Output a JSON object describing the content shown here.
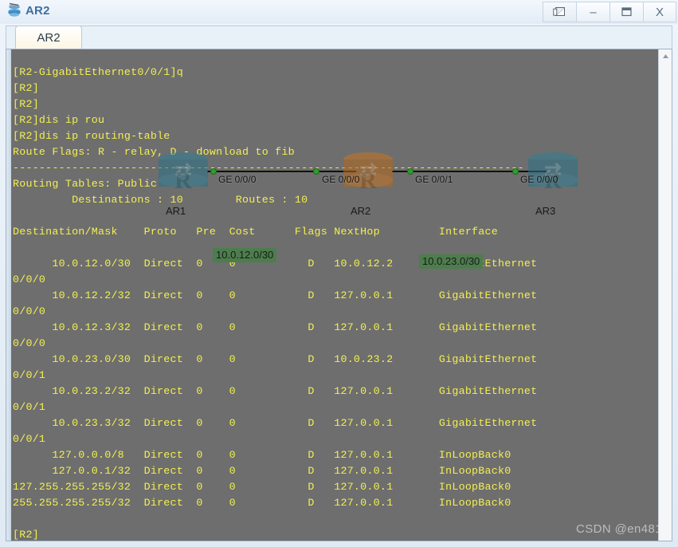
{
  "window": {
    "title": "AR2",
    "app_icon": "router-device-icon",
    "buttons": [
      {
        "name": "detach-window-button",
        "glyph": "❐",
        "label": "Detach"
      },
      {
        "name": "minimize-button",
        "glyph": "–",
        "label": "Minimize"
      },
      {
        "name": "maximize-button",
        "glyph": "▭",
        "label": "Maximize"
      },
      {
        "name": "close-button",
        "glyph": "X",
        "label": "Close"
      }
    ]
  },
  "tabs": [
    {
      "name": "tab-ar2",
      "label": "AR2",
      "active": true
    }
  ],
  "terminal": {
    "background": "#6e6e6e",
    "foreground": "#f3ef52",
    "text": "[R2-GigabitEthernet0/0/1]q\n[R2]\n[R2]\n[R2]dis ip rou\n[R2]dis ip routing-table\nRoute Flags: R - relay, D - download to fib\n------------------------------------------------------------------------------\nRouting Tables: Public\n         Destinations : 10        Routes : 10\n\nDestination/Mask    Proto   Pre  Cost      Flags NextHop         Interface\n\n      10.0.12.0/30  Direct  0    0           D   10.0.12.2       GigabitEthernet\n0/0/0\n      10.0.12.2/32  Direct  0    0           D   127.0.0.1       GigabitEthernet\n0/0/0\n      10.0.12.3/32  Direct  0    0           D   127.0.0.1       GigabitEthernet\n0/0/0\n      10.0.23.0/30  Direct  0    0           D   10.0.23.2       GigabitEthernet\n0/0/1\n      10.0.23.2/32  Direct  0    0           D   127.0.0.1       GigabitEthernet\n0/0/1\n      10.0.23.3/32  Direct  0    0           D   127.0.0.1       GigabitEthernet\n0/0/1\n      127.0.0.0/8   Direct  0    0           D   127.0.0.1       InLoopBack0\n      127.0.0.1/32  Direct  0    0           D   127.0.0.1       InLoopBack0\n127.255.255.255/32  Direct  0    0           D   127.0.0.1       InLoopBack0\n255.255.255.255/32  Direct  0    0           D   127.0.0.1       InLoopBack0\n\n[R2]"
  },
  "routing_table": {
    "flags_legend": "Route Flags: R - relay, D - download to fib",
    "table_name": "Routing Tables: Public",
    "destinations": "10",
    "routes": "10",
    "columns": [
      "Destination/Mask",
      "Proto",
      "Pre",
      "Cost",
      "Flags",
      "NextHop",
      "Interface"
    ],
    "rows": [
      {
        "dest": "10.0.12.0/30",
        "proto": "Direct",
        "pre": "0",
        "cost": "0",
        "flags": "D",
        "nexthop": "10.0.12.2",
        "interface": "GigabitEthernet0/0/0"
      },
      {
        "dest": "10.0.12.2/32",
        "proto": "Direct",
        "pre": "0",
        "cost": "0",
        "flags": "D",
        "nexthop": "127.0.0.1",
        "interface": "GigabitEthernet0/0/0"
      },
      {
        "dest": "10.0.12.3/32",
        "proto": "Direct",
        "pre": "0",
        "cost": "0",
        "flags": "D",
        "nexthop": "127.0.0.1",
        "interface": "GigabitEthernet0/0/0"
      },
      {
        "dest": "10.0.23.0/30",
        "proto": "Direct",
        "pre": "0",
        "cost": "0",
        "flags": "D",
        "nexthop": "10.0.23.2",
        "interface": "GigabitEthernet0/0/1"
      },
      {
        "dest": "10.0.23.2/32",
        "proto": "Direct",
        "pre": "0",
        "cost": "0",
        "flags": "D",
        "nexthop": "127.0.0.1",
        "interface": "GigabitEthernet0/0/1"
      },
      {
        "dest": "10.0.23.3/32",
        "proto": "Direct",
        "pre": "0",
        "cost": "0",
        "flags": "D",
        "nexthop": "127.0.0.1",
        "interface": "GigabitEthernet0/0/1"
      },
      {
        "dest": "127.0.0.0/8",
        "proto": "Direct",
        "pre": "0",
        "cost": "0",
        "flags": "D",
        "nexthop": "127.0.0.1",
        "interface": "InLoopBack0"
      },
      {
        "dest": "127.0.0.1/32",
        "proto": "Direct",
        "pre": "0",
        "cost": "0",
        "flags": "D",
        "nexthop": "127.0.0.1",
        "interface": "InLoopBack0"
      },
      {
        "dest": "127.255.255.255/32",
        "proto": "Direct",
        "pre": "0",
        "cost": "0",
        "flags": "D",
        "nexthop": "127.0.0.1",
        "interface": "InLoopBack0"
      },
      {
        "dest": "255.255.255.255/32",
        "proto": "Direct",
        "pre": "0",
        "cost": "0",
        "flags": "D",
        "nexthop": "127.0.0.1",
        "interface": "InLoopBack0"
      }
    ],
    "prompt": "[R2]"
  },
  "overlay_diagram": {
    "routers": [
      {
        "name": "AR1",
        "label": "AR1",
        "color": "#2f7f96"
      },
      {
        "name": "AR2",
        "label": "AR2",
        "color": "#b5671a"
      },
      {
        "name": "AR3",
        "label": "AR3",
        "color": "#2f7f96"
      }
    ],
    "interface_labels": [
      "GE 0/0/0",
      "GE 0/0/0",
      "GE 0/0/1",
      "GE 0/0/0"
    ],
    "subnet_callouts": [
      "10.0.12.0/30",
      "10.0.23.0/30"
    ],
    "callout_color": "#4d7d4d"
  },
  "scrollbar": {
    "up_arrow": "^"
  },
  "watermark": {
    "text": "CSDN @en481"
  }
}
